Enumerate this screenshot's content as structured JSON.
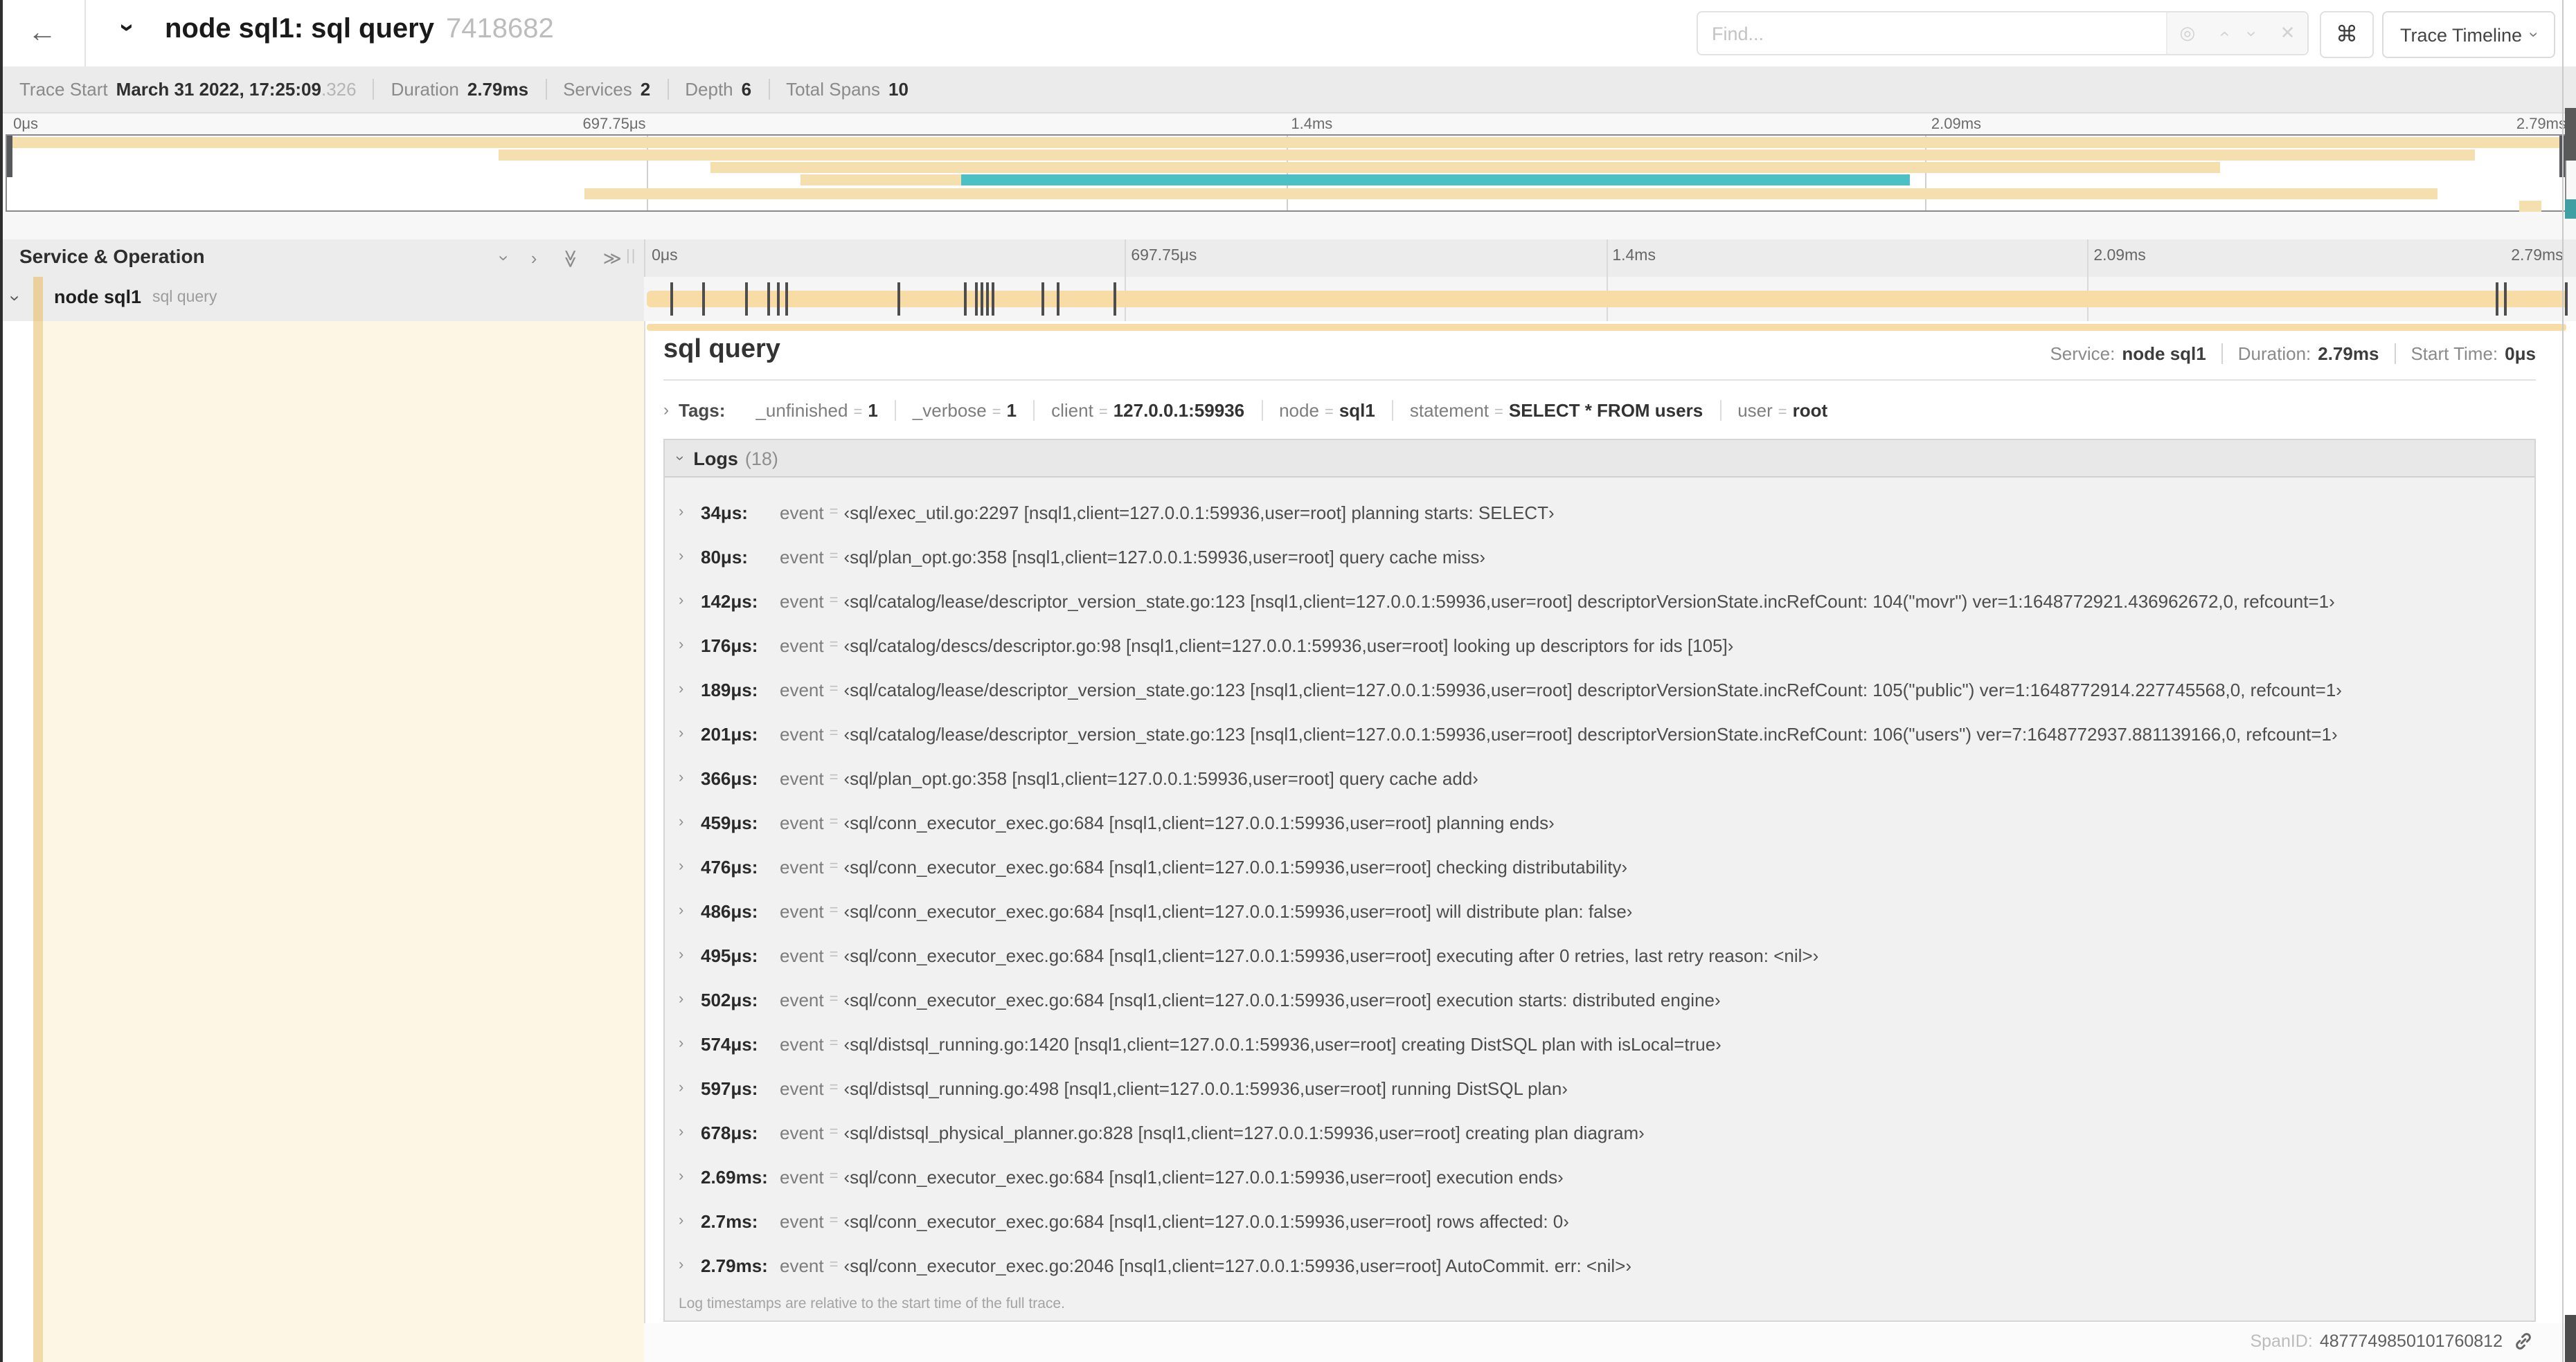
{
  "header": {
    "title": "node sql1: sql query",
    "trace_id": "7418682",
    "find_placeholder": "Find...",
    "shortcut_key": "⌘",
    "view_button": "Trace Timeline"
  },
  "icons": {
    "back": "←",
    "chevron": "›",
    "double_chevron": "≫",
    "crosshair": "◎",
    "clear": "✕",
    "resizer": "||"
  },
  "summary": {
    "items": [
      {
        "label": "Trace Start",
        "value": "March 31 2022, 17:25:09",
        "suffix": ".326"
      },
      {
        "label": "Duration",
        "value": "2.79ms"
      },
      {
        "label": "Services",
        "value": "2"
      },
      {
        "label": "Depth",
        "value": "6"
      },
      {
        "label": "Total Spans",
        "value": "10"
      }
    ]
  },
  "minimap": {
    "ticks": [
      {
        "label": "0μs",
        "pct": 0.3,
        "anchor": "left"
      },
      {
        "label": "697.75μs",
        "pct": 25.0,
        "anchor": "right"
      },
      {
        "label": "1.4ms",
        "pct": 50.2,
        "anchor": "left"
      },
      {
        "label": "2.09ms",
        "pct": 75.2,
        "anchor": "left"
      },
      {
        "label": "2.79ms",
        "pct": 100,
        "anchor": "right"
      }
    ],
    "gridline_pcts": [
      25,
      50,
      75
    ],
    "bars": [
      {
        "row": 0,
        "left": 0,
        "width": 100,
        "color": "tan"
      },
      {
        "row": 1,
        "left": 19.2,
        "width": 77.3,
        "color": "tan"
      },
      {
        "row": 2,
        "left": 27.5,
        "width": 59.0,
        "color": "tan"
      },
      {
        "row": 3,
        "left": 31.0,
        "width": 6.3,
        "color": "tan"
      },
      {
        "row": 3,
        "left": 37.3,
        "width": 37.1,
        "color": "teal"
      },
      {
        "row": 4,
        "left": 22.6,
        "width": 72.4,
        "color": "tan"
      },
      {
        "row": 5,
        "left": 98.2,
        "width": 0.9,
        "color": "tan"
      }
    ]
  },
  "timeline": {
    "header": "Service & Operation",
    "axis_ticks": [
      {
        "label": "0μs",
        "pct": 0.4,
        "anchor": "left"
      },
      {
        "label": "697.75μs",
        "pct": 25.3,
        "anchor": "left"
      },
      {
        "label": "1.4ms",
        "pct": 50.3,
        "anchor": "left"
      },
      {
        "label": "2.09ms",
        "pct": 75.3,
        "anchor": "left"
      },
      {
        "label": "2.79ms",
        "pct": 99.7,
        "anchor": "right"
      }
    ],
    "span_row": {
      "service": "node sql1",
      "operation": "sql query"
    },
    "log_marker_pcts": [
      1.2,
      2.9,
      5.1,
      6.3,
      6.8,
      7.2,
      13.1,
      16.5,
      17.1,
      17.4,
      17.7,
      18.0,
      20.6,
      21.4,
      24.3,
      96.4,
      96.8,
      100
    ]
  },
  "detail": {
    "title": "sql query",
    "meta": [
      {
        "label": "Service:",
        "value": "node sql1"
      },
      {
        "label": "Duration:",
        "value": "2.79ms"
      },
      {
        "label": "Start Time:",
        "value": "0μs"
      }
    ],
    "tags_label": "Tags:",
    "eq": "=",
    "tags": [
      {
        "key": "_unfinished",
        "value": "1"
      },
      {
        "key": "_verbose",
        "value": "1"
      },
      {
        "key": "client",
        "value": "127.0.0.1:59936"
      },
      {
        "key": "node",
        "value": "sql1"
      },
      {
        "key": "statement",
        "value": "SELECT * FROM users"
      },
      {
        "key": "user",
        "value": "root"
      }
    ],
    "logs_label": "Logs",
    "logs_count": "(18)",
    "log_field_key": "event",
    "logs": [
      {
        "t": "34μs:",
        "v": "‹sql/exec_util.go:2297 [nsql1,client=127.0.0.1:59936,user=root] planning starts: SELECT›"
      },
      {
        "t": "80μs:",
        "v": "‹sql/plan_opt.go:358 [nsql1,client=127.0.0.1:59936,user=root] query cache miss›"
      },
      {
        "t": "142μs:",
        "v": "‹sql/catalog/lease/descriptor_version_state.go:123 [nsql1,client=127.0.0.1:59936,user=root] descriptorVersionState.incRefCount: 104(\"movr\") ver=1:1648772921.436962672,0, refcount=1›"
      },
      {
        "t": "176μs:",
        "v": "‹sql/catalog/descs/descriptor.go:98 [nsql1,client=127.0.0.1:59936,user=root] looking up descriptors for ids [105]›"
      },
      {
        "t": "189μs:",
        "v": "‹sql/catalog/lease/descriptor_version_state.go:123 [nsql1,client=127.0.0.1:59936,user=root] descriptorVersionState.incRefCount: 105(\"public\") ver=1:1648772914.227745568,0, refcount=1›"
      },
      {
        "t": "201μs:",
        "v": "‹sql/catalog/lease/descriptor_version_state.go:123 [nsql1,client=127.0.0.1:59936,user=root] descriptorVersionState.incRefCount: 106(\"users\") ver=7:1648772937.881139166,0, refcount=1›"
      },
      {
        "t": "366μs:",
        "v": "‹sql/plan_opt.go:358 [nsql1,client=127.0.0.1:59936,user=root] query cache add›"
      },
      {
        "t": "459μs:",
        "v": "‹sql/conn_executor_exec.go:684 [nsql1,client=127.0.0.1:59936,user=root] planning ends›"
      },
      {
        "t": "476μs:",
        "v": "‹sql/conn_executor_exec.go:684 [nsql1,client=127.0.0.1:59936,user=root] checking distributability›"
      },
      {
        "t": "486μs:",
        "v": "‹sql/conn_executor_exec.go:684 [nsql1,client=127.0.0.1:59936,user=root] will distribute plan: false›"
      },
      {
        "t": "495μs:",
        "v": "‹sql/conn_executor_exec.go:684 [nsql1,client=127.0.0.1:59936,user=root] executing after 0 retries, last retry reason: <nil>›"
      },
      {
        "t": "502μs:",
        "v": "‹sql/conn_executor_exec.go:684 [nsql1,client=127.0.0.1:59936,user=root] execution starts: distributed engine›"
      },
      {
        "t": "574μs:",
        "v": "‹sql/distsql_running.go:1420 [nsql1,client=127.0.0.1:59936,user=root] creating DistSQL plan with isLocal=true›"
      },
      {
        "t": "597μs:",
        "v": "‹sql/distsql_running.go:498 [nsql1,client=127.0.0.1:59936,user=root] running DistSQL plan›"
      },
      {
        "t": "678μs:",
        "v": "‹sql/distsql_physical_planner.go:828 [nsql1,client=127.0.0.1:59936,user=root] creating plan diagram›"
      },
      {
        "t": "2.69ms:",
        "v": "‹sql/conn_executor_exec.go:684 [nsql1,client=127.0.0.1:59936,user=root] execution ends›"
      },
      {
        "t": "2.7ms:",
        "v": "‹sql/conn_executor_exec.go:684 [nsql1,client=127.0.0.1:59936,user=root] rows affected: 0›"
      },
      {
        "t": "2.79ms:",
        "v": "‹sql/conn_executor_exec.go:2046 [nsql1,client=127.0.0.1:59936,user=root] AutoCommit. err: <nil>›"
      }
    ],
    "logs_footer": "Log timestamps are relative to the start time of the full trace.",
    "span_id_label": "SpanID:",
    "span_id": "4877749850101760812"
  },
  "colors": {
    "tan_minimap": "#f5dfae",
    "tan_bar": "#f8dca6",
    "teal": "#4cc0c4",
    "service_accent": "#ecd09c",
    "detail_cream": "#fdf6e5"
  }
}
